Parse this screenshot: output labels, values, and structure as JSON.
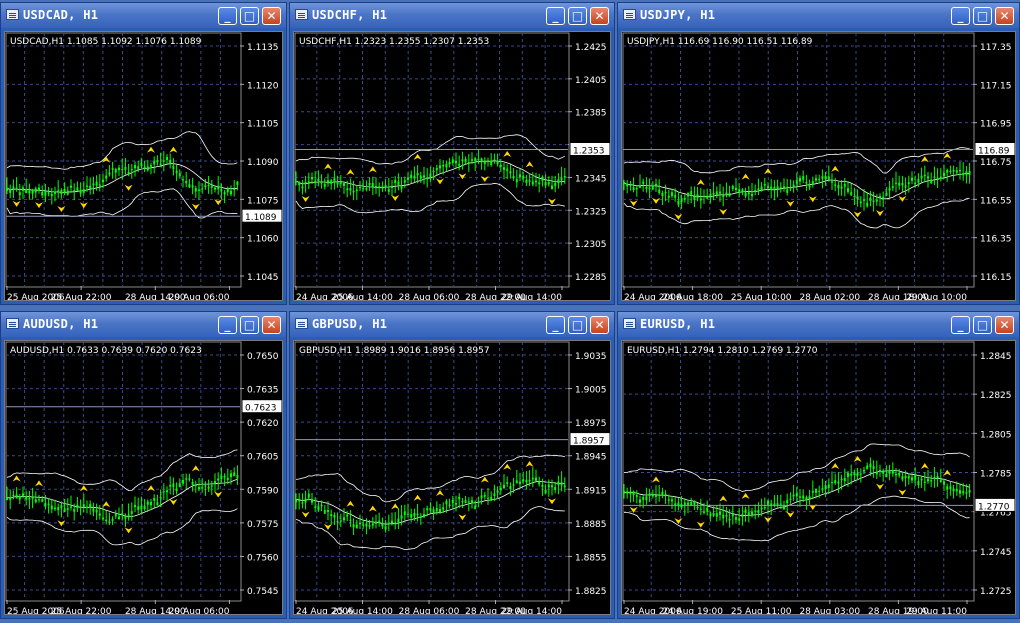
{
  "colors": {
    "background": "#000000",
    "grid": "#3a4a8c",
    "candle": "#00ff00",
    "band": "#ffffff",
    "fractal": "#ffd800",
    "text": "#ffffff"
  },
  "window_buttons": {
    "minimize": "minimize-icon",
    "maximize": "maximize-icon",
    "close": "close-icon"
  },
  "windows": [
    {
      "title": "USDCAD, H1",
      "header": "USDCAD,H1  1.1085 1.1092 1.1076 1.1089",
      "price_tag": "1.1089",
      "y_ticks": [
        "1.1135",
        "1.1120",
        "1.1105",
        "1.1090",
        "1.1075",
        "1.1060",
        "1.1045"
      ],
      "x_ticks": [
        "25 Aug 2006",
        "25 Aug 22:00",
        "28 Aug 14:00",
        "29 Aug 06:00"
      ]
    },
    {
      "title": "USDCHF, H1",
      "header": "USDCHF,H1  1.2323 1.2355 1.2307 1.2353",
      "price_tag": "1.2353",
      "y_ticks": [
        "1.2425",
        "1.2405",
        "1.2385",
        "1.2365",
        "1.2345",
        "1.2325",
        "1.2305",
        "1.2285"
      ],
      "x_ticks": [
        "24 Aug 2006",
        "25 Aug 14:00",
        "28 Aug 06:00",
        "28 Aug 22:00",
        "29 Aug 14:00"
      ]
    },
    {
      "title": "USDJPY, H1",
      "header": "USDJPY,H1  116.69 116.90 116.51 116.89",
      "price_tag": "116.89",
      "y_ticks": [
        "117.35",
        "117.15",
        "116.95",
        "116.75",
        "116.55",
        "116.35",
        "116.15"
      ],
      "x_ticks": [
        "24 Aug 2006",
        "24 Aug 18:00",
        "25 Aug 10:00",
        "28 Aug 02:00",
        "28 Aug 18:00",
        "29 Aug 10:00"
      ]
    },
    {
      "title": "AUDUSD, H1",
      "header": "AUDUSD,H1  0.7633 0.7639 0.7620 0.7623",
      "price_tag": "0.7623",
      "y_ticks": [
        "0.7650",
        "0.7635",
        "0.7620",
        "0.7605",
        "0.7590",
        "0.7575",
        "0.7560",
        "0.7545"
      ],
      "x_ticks": [
        "25 Aug 2006",
        "25 Aug 22:00",
        "28 Aug 14:00",
        "29 Aug 06:00"
      ]
    },
    {
      "title": "GBPUSD, H1",
      "header": "GBPUSD,H1  1.8989 1.9016 1.8956 1.8957",
      "price_tag": "1.8957",
      "y_ticks": [
        "1.9035",
        "1.9005",
        "1.8975",
        "1.8945",
        "1.8915",
        "1.8885",
        "1.8855",
        "1.8825"
      ],
      "x_ticks": [
        "24 Aug 2006",
        "25 Aug 14:00",
        "28 Aug 06:00",
        "28 Aug 22:00",
        "29 Aug 14:00"
      ]
    },
    {
      "title": "EURUSD, H1",
      "header": "EURUSD,H1  1.2794 1.2810 1.2769 1.2770",
      "price_tag": "1.2770",
      "y_ticks": [
        "1.2845",
        "1.2825",
        "1.2805",
        "1.2785",
        "1.2765",
        "1.2745",
        "1.2725"
      ],
      "x_ticks": [
        "24 Aug 2006",
        "24 Aug 19:00",
        "25 Aug 11:00",
        "28 Aug 03:00",
        "28 Aug 19:00",
        "29 Aug 11:00"
      ]
    }
  ]
}
